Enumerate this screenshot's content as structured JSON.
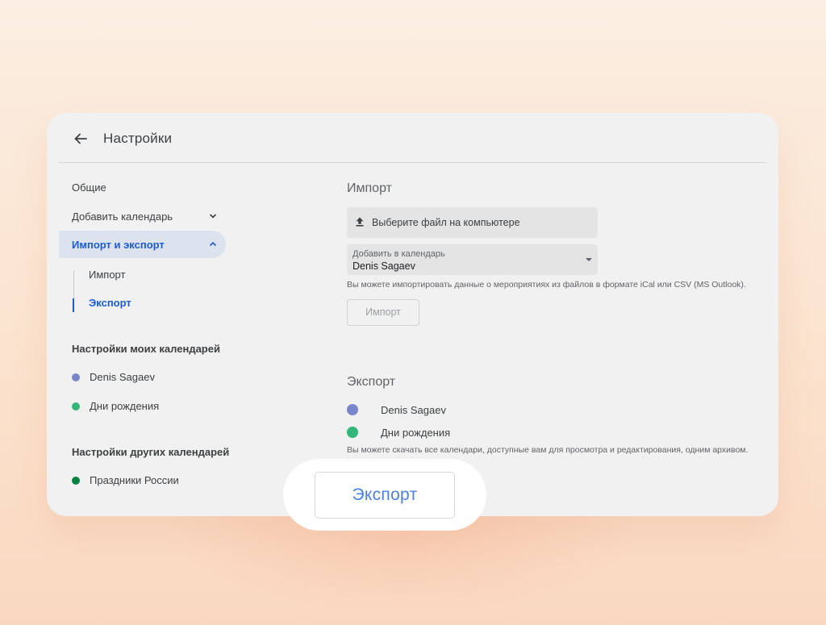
{
  "header": {
    "title": "Настройки"
  },
  "nav": {
    "general": "Общие",
    "add_calendar": "Добавить календарь",
    "import_export": "Импорт и экспорт",
    "sub_import": "Импорт",
    "sub_export": "Экспорт",
    "my_calendars_heading": "Настройки моих календарей",
    "my_calendars": [
      {
        "name": "Denis Sagaev",
        "color": "#7986cb"
      },
      {
        "name": "Дни рождения",
        "color": "#33b679"
      }
    ],
    "other_calendars_heading": "Настройки других календарей",
    "other_calendars": [
      {
        "name": "Праздники России",
        "color": "#0b8043"
      }
    ]
  },
  "import": {
    "heading": "Импорт",
    "file_button": "Выберите файл на компьютере",
    "select_caption": "Добавить в календарь",
    "select_value": "Denis Sagaev",
    "help": "Вы можете импортировать данные о мероприятиях из файлов в формате iCal или CSV (MS Outlook).",
    "button": "Импорт"
  },
  "export": {
    "heading": "Экспорт",
    "calendars": [
      {
        "name": "Denis Sagaev",
        "color": "#7986cb"
      },
      {
        "name": "Дни рождения",
        "color": "#33b679"
      }
    ],
    "help": "Вы можете скачать все календари, доступные вам для просмотра и редактирования, одним архивом.",
    "button": "Экспорт"
  },
  "colors": {
    "accent": "#1a5bd6",
    "active_bg": "#dde3ee",
    "export_text": "#4a80e0"
  }
}
